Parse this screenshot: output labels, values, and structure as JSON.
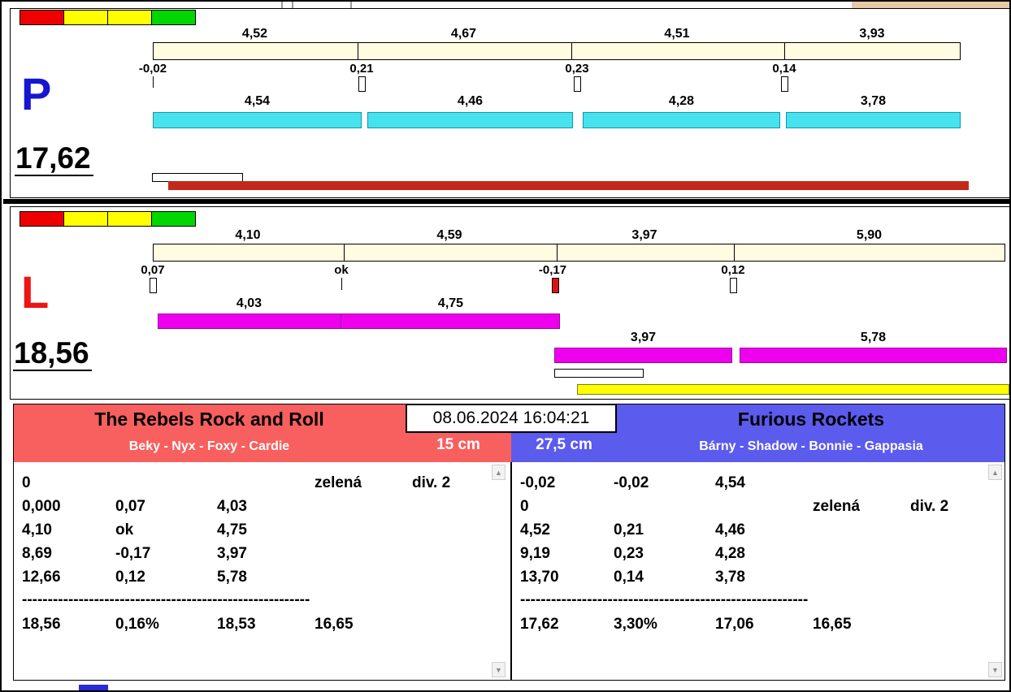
{
  "meta": {
    "datetime": "08.06.2024 16:04:21"
  },
  "colors": {
    "cream_bar": "#fffce1",
    "cyan_bar": "#48e2ee",
    "magenta_bar": "#ee00ee",
    "red_progress_bar": "#c3291b",
    "yellow_progress_bar": "#ffff00",
    "team_left_bg": "#f7605f",
    "team_right_bg": "#5b5bee",
    "letter_p": "#1616d1",
    "letter_l": "#ee1414",
    "status_lights": [
      "#ee0000",
      "#ffff00",
      "#ffff00",
      "#00d600"
    ]
  },
  "lane_p": {
    "letter": "P",
    "total": "17,62",
    "splits_top": [
      "4,52",
      "4,67",
      "4,51",
      "3,93"
    ],
    "deltas": [
      "-0,02",
      "0,21",
      "0,23",
      "0,14"
    ],
    "splits_bottom": [
      "4,54",
      "4,46",
      "4,28",
      "3,78"
    ]
  },
  "lane_l": {
    "letter": "L",
    "total": "18,56",
    "splits_top": [
      "4,10",
      "4,59",
      "3,97",
      "5,90"
    ],
    "deltas": [
      "0,07",
      "ok",
      "-0,17",
      "0,12"
    ],
    "splits_mid": [
      "4,03",
      "4,75"
    ],
    "splits_low": [
      "3,97",
      "5,78"
    ]
  },
  "team_left": {
    "name": "The Rebels Rock and Roll",
    "dogs": "Beky - Nyx - Foxy - Cardie",
    "height": "15 cm",
    "lines": [
      [
        "0",
        "",
        "",
        "zelená",
        "div. 2"
      ],
      [
        "0,000",
        "0,07",
        "4,03",
        "",
        ""
      ],
      [
        "4,10",
        "ok",
        "4,75",
        "",
        ""
      ],
      [
        "8,69",
        "-0,17",
        "3,97",
        "",
        ""
      ],
      [
        "12,66",
        "0,12",
        "5,78",
        "",
        ""
      ]
    ],
    "separator": "--------------------------------------------------------",
    "totals": [
      "18,56",
      "0,16%",
      "18,53",
      "16,65"
    ]
  },
  "team_right": {
    "name": "Furious Rockets",
    "dogs": "Bárny - Shadow - Bonnie - Gappasia",
    "height": "27,5 cm",
    "lines": [
      [
        "-0,02",
        "-0,02",
        "4,54",
        "",
        ""
      ],
      [
        "0",
        "",
        "",
        "zelená",
        "div. 2"
      ],
      [
        "4,52",
        "0,21",
        "4,46",
        "",
        ""
      ],
      [
        "9,19",
        "0,23",
        "4,28",
        "",
        ""
      ],
      [
        "13,70",
        "0,14",
        "3,78",
        "",
        ""
      ]
    ],
    "separator": "--------------------------------------------------------",
    "totals": [
      "17,62",
      "3,30%",
      "17,06",
      "16,65"
    ]
  }
}
